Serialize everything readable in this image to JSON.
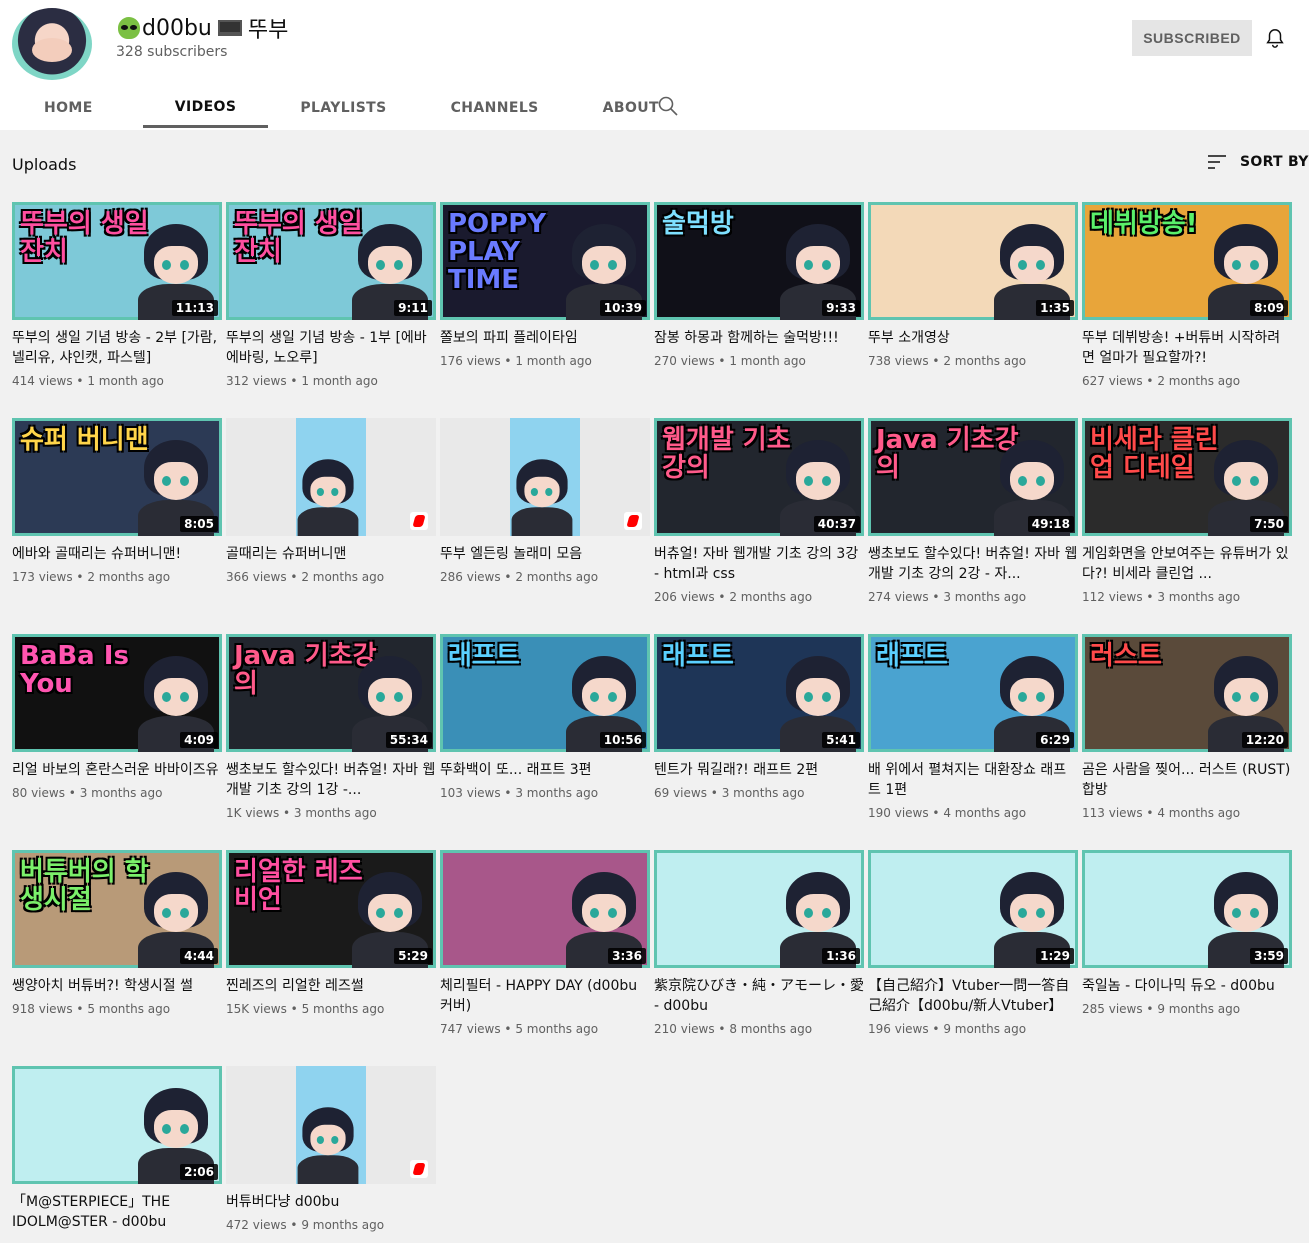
{
  "channel": {
    "name": "d00bu",
    "name_suffix": "뚜부",
    "subscribers": "328 subscribers",
    "subscribe_label": "SUBSCRIBED"
  },
  "tabs": [
    {
      "label": "HOME",
      "active": false
    },
    {
      "label": "VIDEOS",
      "active": true
    },
    {
      "label": "PLAYLISTS",
      "active": false
    },
    {
      "label": "CHANNELS",
      "active": false
    },
    {
      "label": "ABOUT",
      "active": false
    }
  ],
  "section": {
    "title": "Uploads",
    "sort_label": "SORT BY"
  },
  "videos": [
    {
      "title": "뚜부의 생일 기념 방송 - 2부 [가람, 넬리유, 샤인캣, 파스텔]",
      "views": "414 views",
      "age": "1 month ago",
      "duration": "11:13",
      "thumb_text": "뚜부의 생일잔치",
      "bg": "#7ec9d8",
      "text_color": "#ff4fa0"
    },
    {
      "title": "뚜부의 생일 기념 방송 - 1부 [에바에바링, 노오루]",
      "views": "312 views",
      "age": "1 month ago",
      "duration": "9:11",
      "thumb_text": "뚜부의 생일잔치",
      "bg": "#7ec9d8",
      "text_color": "#ff4fa0"
    },
    {
      "title": "쫄보의 파피 플레이타임",
      "views": "176 views",
      "age": "1 month ago",
      "duration": "10:39",
      "thumb_text": "POPPY PLAY TIME",
      "bg": "#1a1a2e",
      "text_color": "#6a7bff"
    },
    {
      "title": "잠봉 하몽과 함께하는 술먹방!!!",
      "views": "270 views",
      "age": "1 month ago",
      "duration": "9:33",
      "thumb_text": "술먹방",
      "bg": "#101018",
      "text_color": "#7ee0ff"
    },
    {
      "title": "뚜부 소개영상",
      "views": "738 views",
      "age": "2 months ago",
      "duration": "1:35",
      "thumb_text": "",
      "bg": "#f3d9b8",
      "text_color": "#ffffff"
    },
    {
      "title": "뚜부 데뷔방송! +버튜버 시작하려면 얼마가 필요할까?!",
      "views": "627 views",
      "age": "2 months ago",
      "duration": "8:09",
      "thumb_text": "데뷔방송!",
      "bg": "#e8a53a",
      "text_color": "#5af06a"
    },
    {
      "title": "에바와 골때리는 슈퍼버니맨!",
      "views": "173 views",
      "age": "2 months ago",
      "duration": "8:05",
      "thumb_text": "슈퍼 버니맨",
      "bg": "#2c3a55",
      "text_color": "#ffd54a"
    },
    {
      "title": "골때리는 슈퍼버니맨",
      "views": "366 views",
      "age": "2 months ago",
      "duration": "",
      "short": true,
      "thumb_text": "",
      "bg": "#e9e9e9",
      "text_color": "#ffffff"
    },
    {
      "title": "뚜부 엘든링 놀래미 모음",
      "views": "286 views",
      "age": "2 months ago",
      "duration": "",
      "short": true,
      "thumb_text": "",
      "bg": "#e9e9e9",
      "text_color": "#ffffff"
    },
    {
      "title": "버츄얼! 자바 웹개발 기초 강의 3강 - html과 css",
      "views": "206 views",
      "age": "2 months ago",
      "duration": "40:37",
      "thumb_text": "웹개발 기초강의",
      "bg": "#22262e",
      "text_color": "#ff5a8a"
    },
    {
      "title": "쌩초보도 할수있다! 버츄얼! 자바 웹개발 기초 강의 2강 - 자...",
      "views": "274 views",
      "age": "3 months ago",
      "duration": "49:18",
      "thumb_text": "Java 기초강의",
      "bg": "#22262e",
      "text_color": "#ff5a8a"
    },
    {
      "title": "게임화면을 안보여주는 유튜버가 있다?! 비세라 클린업 ...",
      "views": "112 views",
      "age": "3 months ago",
      "duration": "7:50",
      "thumb_text": "비세라 클린업 디테일",
      "bg": "#2b2b2b",
      "text_color": "#ff4a4a"
    },
    {
      "title": "리얼 바보의 혼란스러운 바바이즈유",
      "views": "80 views",
      "age": "3 months ago",
      "duration": "4:09",
      "thumb_text": "BaBa Is You",
      "bg": "#111111",
      "text_color": "#ff55b0"
    },
    {
      "title": "쌩초보도 할수있다! 버츄얼! 자바 웹개발 기초 강의 1강 -...",
      "views": "1K views",
      "age": "3 months ago",
      "duration": "55:34",
      "thumb_text": "Java 기초강의",
      "bg": "#22262e",
      "text_color": "#ff5a8a"
    },
    {
      "title": "뚜화백이 또... 래프트 3편",
      "views": "103 views",
      "age": "3 months ago",
      "duration": "10:56",
      "thumb_text": "래프트",
      "bg": "#3a8fb7",
      "text_color": "#5ad0ff"
    },
    {
      "title": "텐트가 뭐길래?! 래프트 2편",
      "views": "69 views",
      "age": "3 months ago",
      "duration": "5:41",
      "thumb_text": "래프트",
      "bg": "#1e3557",
      "text_color": "#5ad0ff"
    },
    {
      "title": "배 위에서 펼쳐지는 대환장쇼 래프트 1편",
      "views": "190 views",
      "age": "4 months ago",
      "duration": "6:29",
      "thumb_text": "래프트",
      "bg": "#4aa3d0",
      "text_color": "#5ad0ff"
    },
    {
      "title": "곰은 사람을 찢어... 러스트 (RUST) 합방",
      "views": "113 views",
      "age": "4 months ago",
      "duration": "12:20",
      "thumb_text": "러스트",
      "bg": "#5a4a3a",
      "text_color": "#ff4a4a"
    },
    {
      "title": "쌩양아치 버튜버?! 학생시절 썰",
      "views": "918 views",
      "age": "5 months ago",
      "duration": "4:44",
      "thumb_text": "버튜버의 학생시절",
      "bg": "#b89a78",
      "text_color": "#7bf06a"
    },
    {
      "title": "찐레즈의 리얼한 레즈썰",
      "views": "15K views",
      "age": "5 months ago",
      "duration": "5:29",
      "thumb_text": "리얼한 레즈비언",
      "bg": "#1a1a1a",
      "text_color": "#ff4fa0"
    },
    {
      "title": "체리필터 - HAPPY DAY (d00bu 커버)",
      "views": "747 views",
      "age": "5 months ago",
      "duration": "3:36",
      "thumb_text": "",
      "bg": "#a8578a",
      "text_color": "#ffffff"
    },
    {
      "title": "紫京院ひびき・純・アモーレ・愛 - d00bu",
      "views": "210 views",
      "age": "8 months ago",
      "duration": "1:36",
      "thumb_text": "",
      "bg": "#bfeef0",
      "text_color": "#ffffff"
    },
    {
      "title": "【自己紹介】Vtuber一問一答自己紹介【d00bu/新人Vtuber】",
      "views": "196 views",
      "age": "9 months ago",
      "duration": "1:29",
      "thumb_text": "",
      "bg": "#bfeef0",
      "text_color": "#ffffff"
    },
    {
      "title": "죽일놈 - 다이나믹 듀오 - d00bu",
      "views": "285 views",
      "age": "9 months ago",
      "duration": "3:59",
      "thumb_text": "",
      "bg": "#bfeef0",
      "text_color": "#ffffff"
    },
    {
      "title": "「M@STERPIECE」THE IDOLM@STER - d00bu",
      "views": "",
      "age": "",
      "duration": "2:06",
      "thumb_text": "",
      "bg": "#bfeef0",
      "text_color": "#ffffff"
    },
    {
      "title": "버튜버다냥 d00bu",
      "views": "472 views",
      "age": "9 months ago",
      "duration": "",
      "short": true,
      "thumb_text": "",
      "bg": "#bfeef0",
      "text_color": "#ffffff"
    }
  ]
}
